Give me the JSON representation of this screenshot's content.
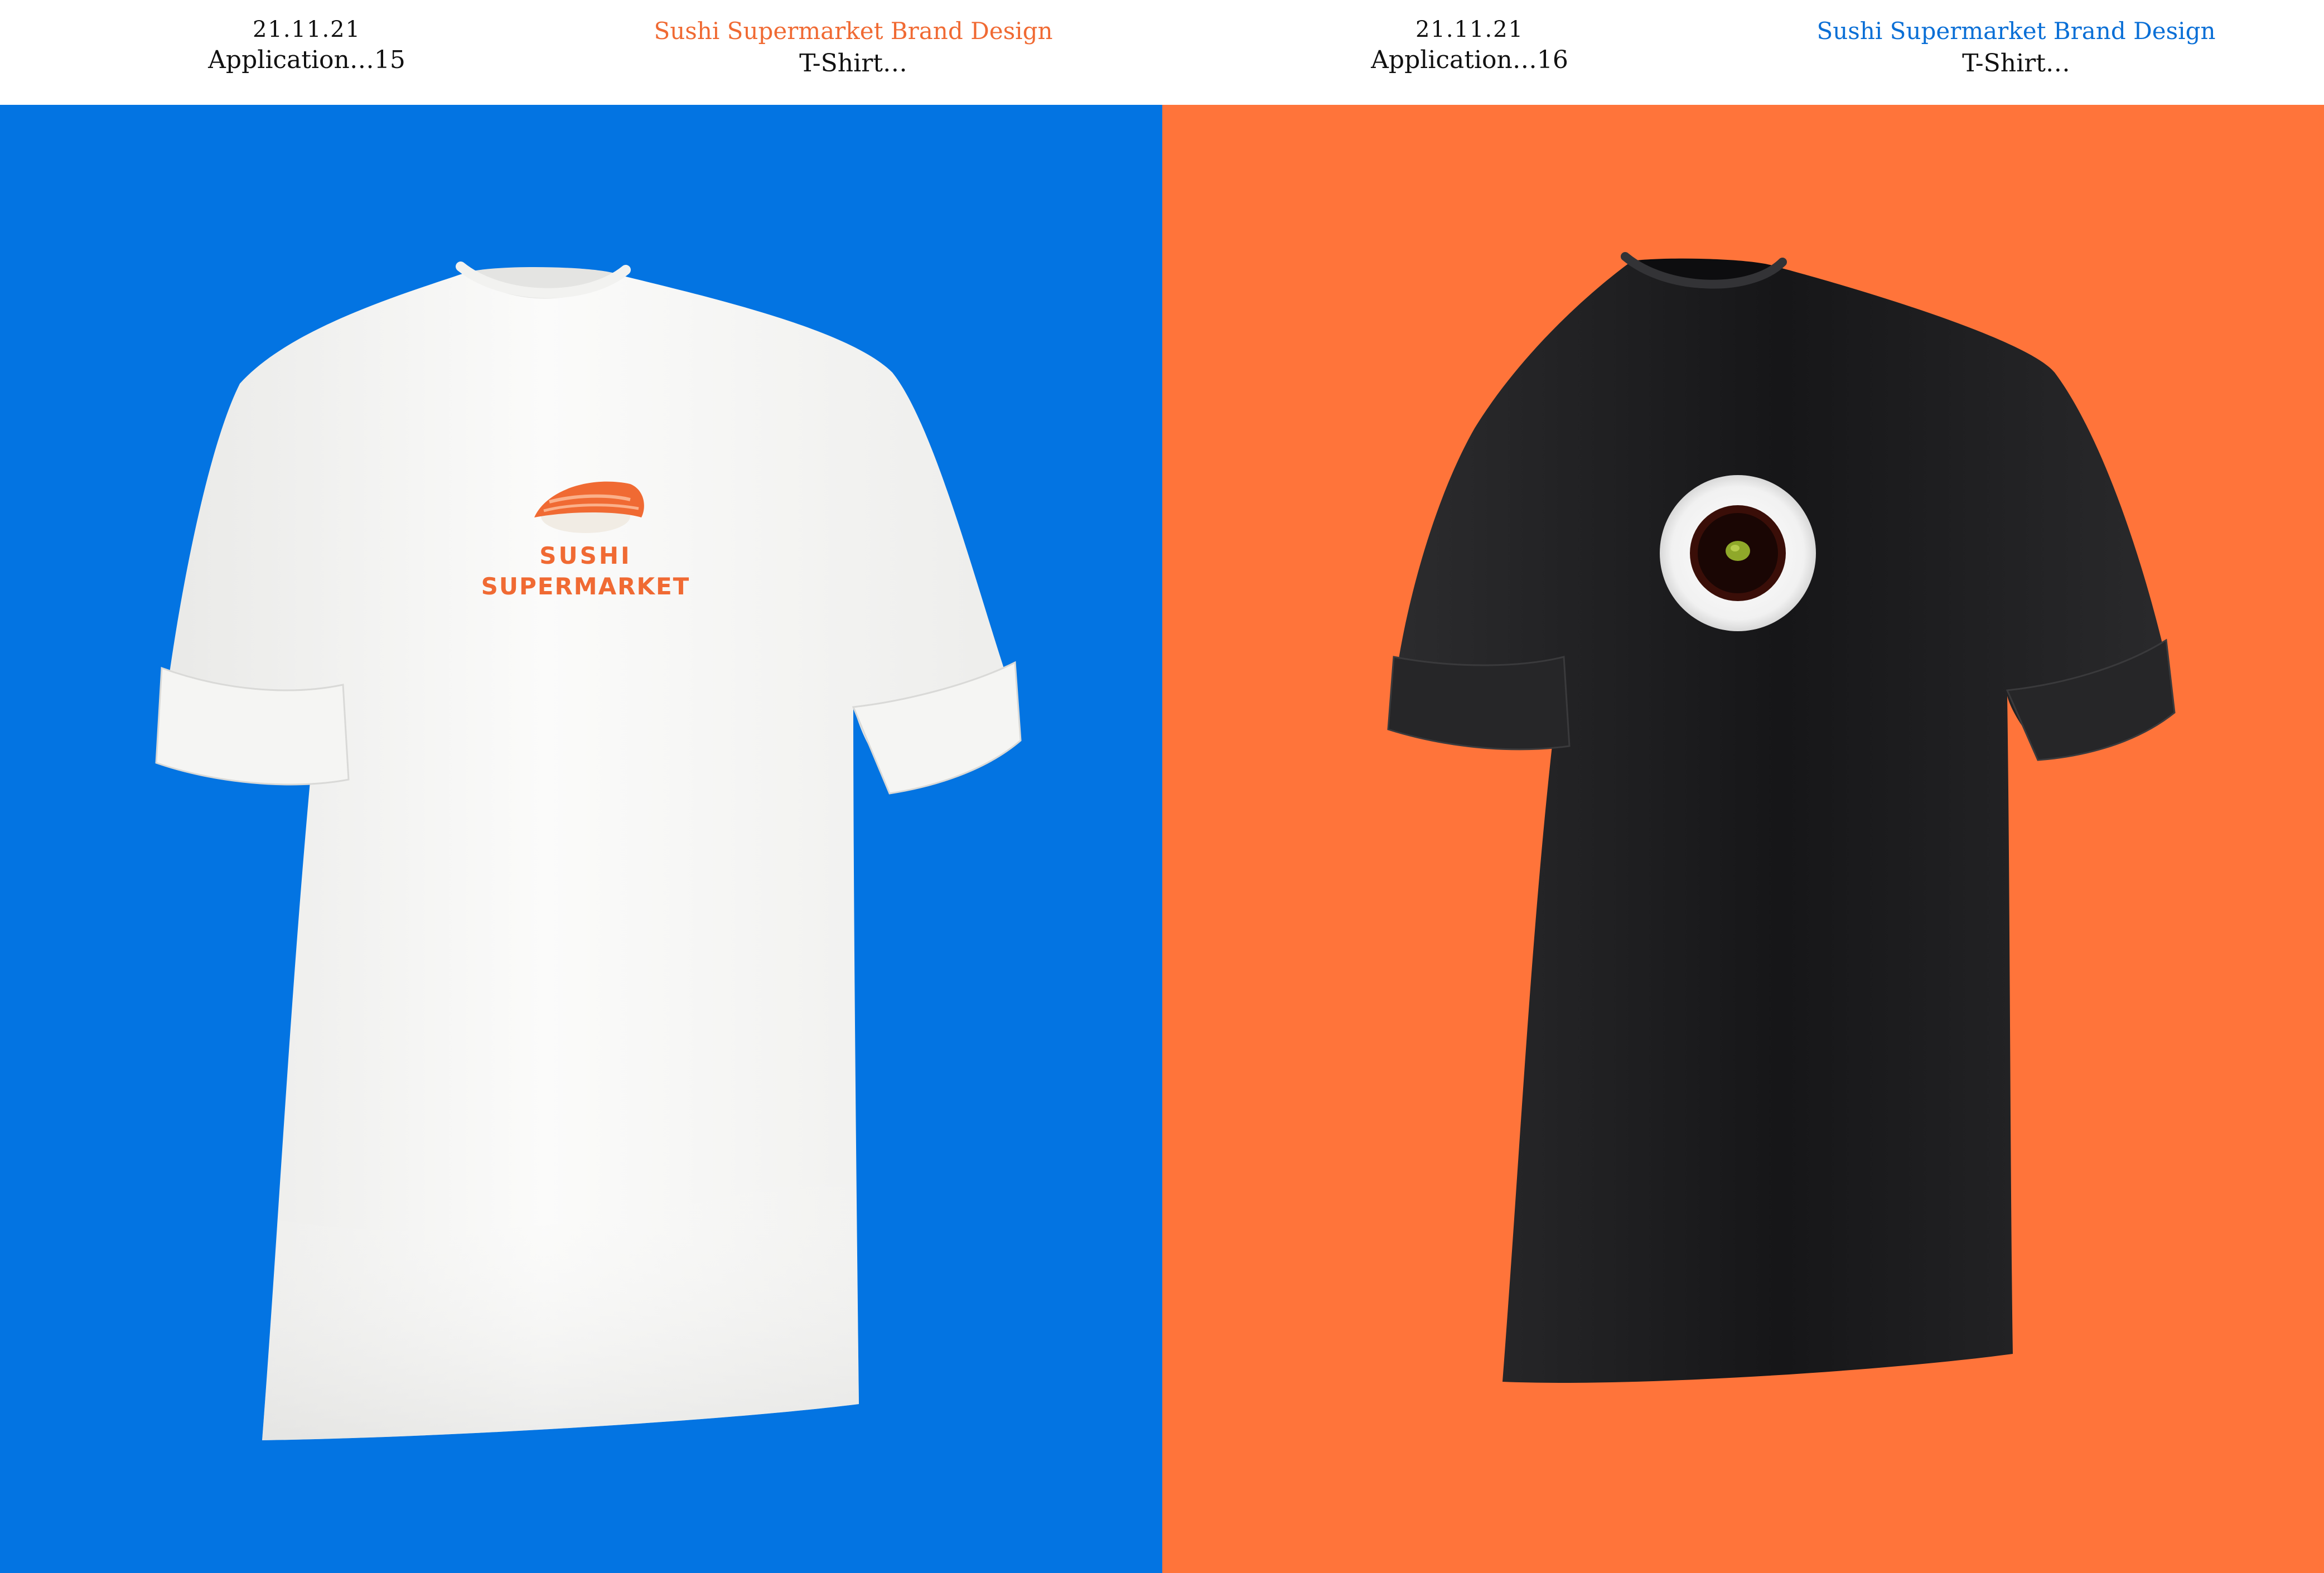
{
  "colors": {
    "left_bg": "#0374e2",
    "right_bg": "#ff743a",
    "accent_orange": "#f06a33",
    "accent_blue": "#0a6fd6",
    "shirt_white": "#f7f7f5",
    "shirt_black": "#1f1f21"
  },
  "left": {
    "date": "21.11.21",
    "application": "Application…15",
    "brand": "Sushi Supermarket Brand Design",
    "item": "T-Shirt…",
    "shirt": {
      "color": "white",
      "print_line1": "SUSHI",
      "print_line2": "SUPERMARKET",
      "print_icon": "salmon-nigiri-icon"
    }
  },
  "right": {
    "date": "21.11.21",
    "application": "Application…16",
    "brand": "Sushi Supermarket Brand Design",
    "item": "T-Shirt…",
    "shirt": {
      "color": "black",
      "print_icon": "soy-sauce-dish-icon"
    }
  }
}
